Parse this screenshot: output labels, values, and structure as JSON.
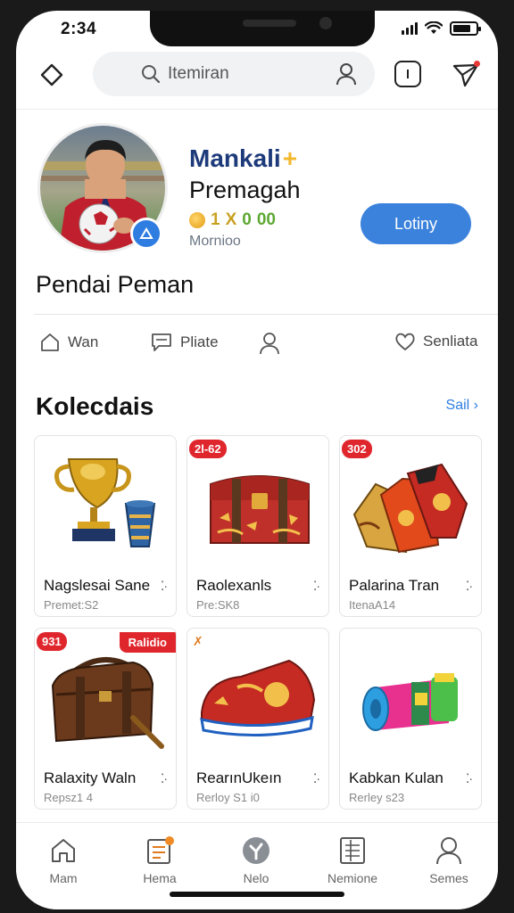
{
  "status_bar": {
    "time": "2:34"
  },
  "search": {
    "placeholder": "Itemiran"
  },
  "profile": {
    "name": "Mankali",
    "name_suffix": "+",
    "subtitle": "Premagah",
    "stat_a": "1",
    "stat_b": "X",
    "stat_c": "0",
    "stat_d": "00",
    "caption": "Mornioo",
    "follow_label": "Lotiny"
  },
  "section_title": "Pendai Peman",
  "actions": [
    {
      "icon": "home-outline-icon",
      "label": "Wan"
    },
    {
      "icon": "message-square-icon",
      "label": "Pliate"
    },
    {
      "icon": "person-icon",
      "label": ""
    },
    {
      "icon": "heart-icon",
      "label": "Senliata"
    }
  ],
  "collections": {
    "title": "Kolecdais",
    "see_all": "Sail",
    "items": [
      {
        "title": "Nagslesai Sane",
        "meta": "Premet:S2",
        "tag": "",
        "tag2": "",
        "icon": "trophy-icon"
      },
      {
        "title": "Raolexanls",
        "meta": "Pre:SK8",
        "tag": "2l-62",
        "tag2": "",
        "icon": "treasure-chest-icon"
      },
      {
        "title": "Palarina Tran",
        "meta": "ItenaA14",
        "tag": "302",
        "tag2": "",
        "icon": "jersey-icon"
      },
      {
        "title": "Ralaxity Waln",
        "meta": "Repsz1 4",
        "tag": "931",
        "tag2": "Ralidio",
        "icon": "leather-bag-icon"
      },
      {
        "title": "RearınUkeın",
        "meta": "Rerloy S1 i0",
        "tag": "✗",
        "tag2": "",
        "icon": "sneaker-icon"
      },
      {
        "title": "Kabkan Kulan",
        "meta": "Rerley s23",
        "tag": "",
        "tag2": "",
        "icon": "rolled-mat-icon"
      }
    ]
  },
  "bottom_nav": [
    {
      "label": "Mam",
      "icon": "home-icon"
    },
    {
      "label": "Hema",
      "icon": "document-icon"
    },
    {
      "label": "Nelo",
      "icon": "pin-icon"
    },
    {
      "label": "Nemione",
      "icon": "list-icon"
    },
    {
      "label": "Semes",
      "icon": "profile-icon"
    }
  ]
}
